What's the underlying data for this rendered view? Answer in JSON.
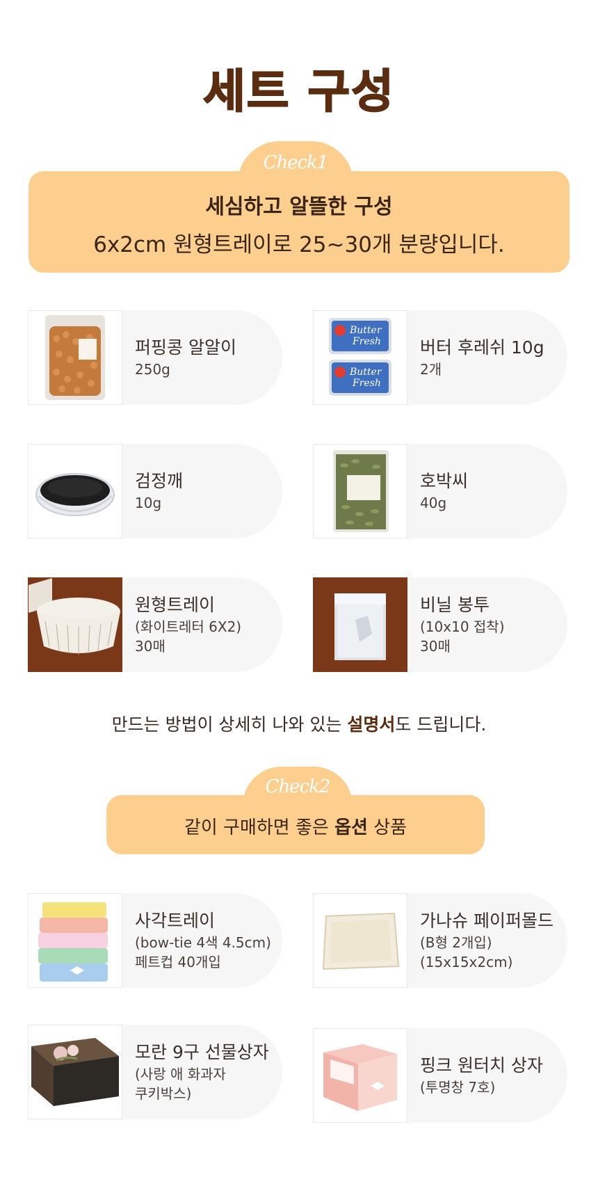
{
  "title": "세트 구성",
  "check1": {
    "tab": "Check1",
    "heading": "세심하고 알뜰한 구성",
    "desc": "6x2cm 원형트레이로 25~30개 분량입니다."
  },
  "items": [
    {
      "name": "퍼핑콩 알알이",
      "lines": [
        "250g"
      ],
      "photo": "beans-bag-photo"
    },
    {
      "name": "버터 후레쉬 10g",
      "lines": [
        "2개"
      ],
      "photo": "butter-pack-photo"
    },
    {
      "name": "검정깨",
      "lines": [
        "10g"
      ],
      "photo": "black-sesame-photo"
    },
    {
      "name": "호박씨",
      "lines": [
        "40g"
      ],
      "photo": "pumpkin-seed-photo"
    },
    {
      "name": "원형트레이",
      "lines": [
        "(화이트레터 6X2)",
        "30매"
      ],
      "photo": "round-tray-photo"
    },
    {
      "name": "비닐 봉투",
      "lines": [
        "(10x10 접착)",
        "30매"
      ],
      "photo": "vinyl-bag-photo"
    }
  ],
  "manual": {
    "before": "만드는 방법이 상세히 나와 있는 ",
    "bold": "설명서",
    "after": "도 드립니다."
  },
  "check2": {
    "tab": "Check2",
    "before": "같이 구매하면 좋은 ",
    "bold": "옵션",
    "after": " 상품"
  },
  "options": [
    {
      "name": "사각트레이",
      "lines": [
        "(bow-tie 4색 4.5cm)",
        "페트컵 40개입"
      ],
      "photo": "square-tray-photo"
    },
    {
      "name": "가나슈 페이퍼몰드",
      "lines": [
        "(B형 2개입)",
        "(15x15x2cm)"
      ],
      "photo": "paper-mold-photo"
    },
    {
      "name": "모란 9구 선물상자",
      "lines": [
        "(사랑 애 화과자",
        "쿠키박스)"
      ],
      "photo": "gift-box-photo"
    },
    {
      "name": "핑크 원터치 상자",
      "lines": [
        "(투명창 7호)"
      ],
      "photo": "pink-box-photo"
    }
  ],
  "colors": {
    "accent": "#fccf8e",
    "title": "#5a2c10",
    "card": "#f6f6f6",
    "brownBg": "#7a3818",
    "wave": "#e5643a"
  }
}
